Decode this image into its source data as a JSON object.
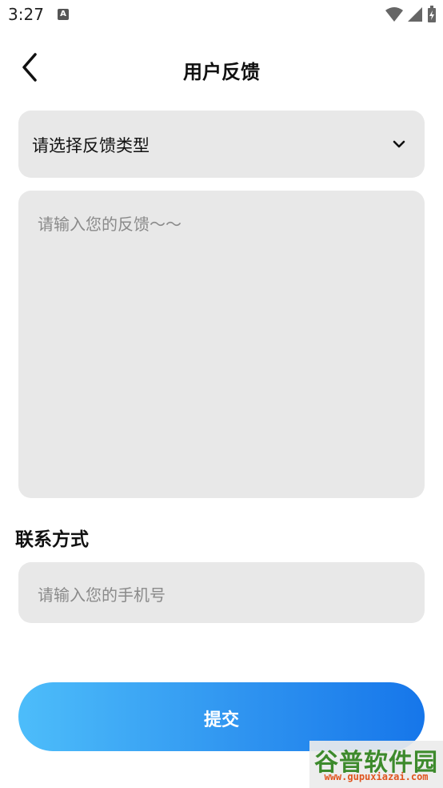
{
  "status_bar": {
    "time": "3:27",
    "notification_icon": "A",
    "icons": [
      "wifi-icon",
      "signal-icon",
      "battery-charging-icon"
    ]
  },
  "header": {
    "back_icon": "chevron-left-icon",
    "title": "用户反馈"
  },
  "feedback_type": {
    "selected_label": "请选择反馈类型",
    "icon": "chevron-down-icon"
  },
  "feedback_text": {
    "placeholder": "请输入您的反馈～～"
  },
  "contact": {
    "heading": "联系方式",
    "phone_placeholder": "请输入您的手机号"
  },
  "submit": {
    "label": "提交"
  },
  "watermark": {
    "brand": "谷普软件园",
    "url": "www.gupuxiazai.com"
  },
  "colors": {
    "field_bg": "#e8e8e8",
    "submit_gradient_start": "#4dbdfa",
    "submit_gradient_end": "#1676ea",
    "placeholder": "#8a8a8a"
  }
}
